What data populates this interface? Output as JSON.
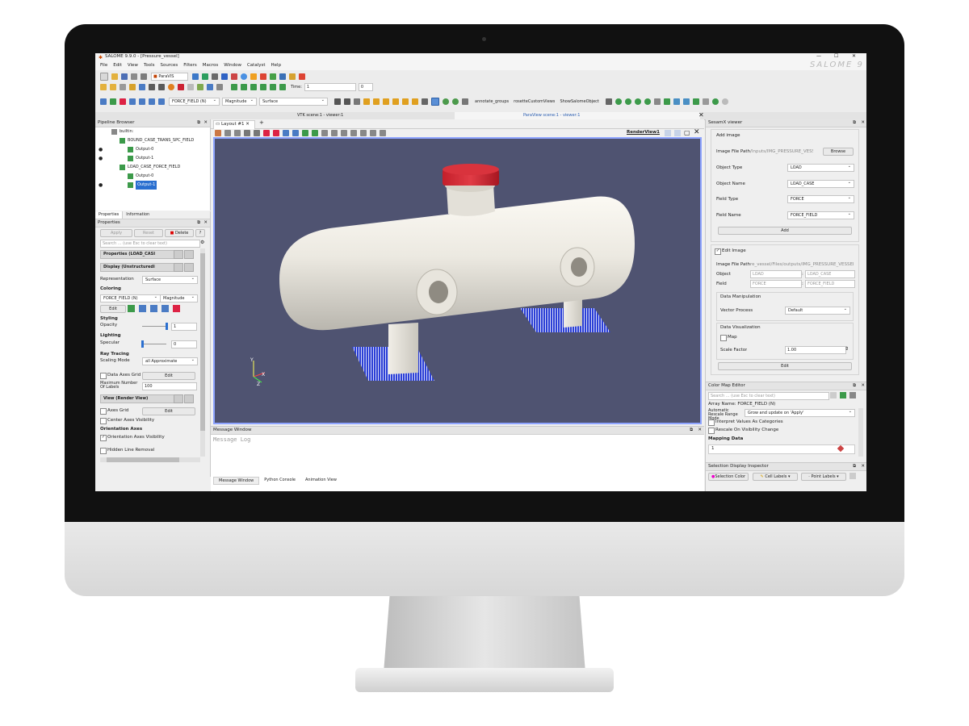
{
  "window": {
    "title": "SALOME 9.9.0 - [Pressure_vessel]",
    "brand": "SALOME 9"
  },
  "menu": [
    "File",
    "Edit",
    "View",
    "Tools",
    "Sources",
    "Filters",
    "Macros",
    "Window",
    "Catalyst",
    "Help"
  ],
  "toolbar": {
    "module_select": "ParaVIS",
    "time_label": "Time:",
    "time_value": "1",
    "time_step": "0",
    "color_field": "FORCE_FIELD (N)",
    "color_component": "Magnitude",
    "representation": "Surface",
    "macro_buttons": [
      "annotate_groups",
      "rosetteCustomViews",
      "ShowSalomeObject"
    ]
  },
  "viewer_tabs": {
    "vtk": "VTK scene:1 - viewer:1",
    "paraview": "ParaView scene:1 - viewer:1"
  },
  "pipeline": {
    "title": "Pipeline Browser",
    "items": [
      "builtin:",
      "BOUND_CASE_TRANS_SPC_FIELD",
      "Output-0",
      "Output-1",
      "LOAD_CASE_FORCE_FIELD",
      "Output-0",
      "Output-1"
    ]
  },
  "props": {
    "tabs": [
      "Properties",
      "Information"
    ],
    "title": "Properties",
    "apply": "Apply",
    "reset": "Reset",
    "delete": "Delete",
    "help": "?",
    "search_placeholder": "Search ... (use Esc to clear text)",
    "group_properties": "Properties (LOAD_CASI",
    "group_display": "Display (Unstructuredi",
    "representation_label": "Representation",
    "representation_value": "Surface",
    "coloring": "Coloring",
    "color_field": "FORCE_FIELD (N)",
    "color_component": "Magnitude",
    "edit": "Edit",
    "styling": "Styling",
    "opacity_label": "Opacity",
    "opacity_value": "1",
    "lighting": "Lighting",
    "specular_label": "Specular",
    "specular_value": "0",
    "ray_tracing": "Ray Tracing",
    "scaling_mode_label": "Scaling Mode",
    "scaling_mode_value": "all Approximate",
    "data_axes_grid": "Data Axes Grid",
    "edit2": "Edit",
    "max_labels_label": "Maximum Number Of Labels",
    "max_labels_value": "100",
    "group_view": "View (Render View)",
    "axes_grid": "Axes Grid",
    "edit3": "Edit",
    "center_axes": "Center Axes Visibility",
    "orientation_axes": "Orientation Axes",
    "orientation_visibility": "Orientation Axes Visibility",
    "hidden_line": "Hidden Line Removal"
  },
  "layout": {
    "tab": "Layout #1",
    "render_view": "RenderView1"
  },
  "message": {
    "title": "Message Window",
    "log": "Message Log",
    "tabs": [
      "Message Window",
      "Python Console",
      "Animation View"
    ]
  },
  "sesamx": {
    "title": "SesamX viewer",
    "add_image": "Add image",
    "file_path_label": "Image File Path",
    "file_path_value": "/Inputs/IMG_PRESSURE_VESSEL.h5",
    "browse": "Browse",
    "object_type_label": "Object Type",
    "object_type_value": "LOAD",
    "object_name_label": "Object Name",
    "object_name_value": "LOAD_CASE",
    "field_type_label": "Field Type",
    "field_type_value": "FORCE",
    "field_name_label": "Field Name",
    "field_name_value": "FORCE_FIELD",
    "add": "Add",
    "edit_image": "Edit Image",
    "edit_path_label": "Image File Path",
    "edit_path_value": "re_vessel/Files/outputs/IMG_PRESSURE_VESSEL.h5",
    "object_label": "Object",
    "object_a": "LOAD",
    "object_b": "LOAD_CASE",
    "field_label": "Field",
    "field_a": "FORCE",
    "field_b": "FORCE_FIELD",
    "data_manipulation": "Data Manipulation",
    "vector_process_label": "Vector Process",
    "vector_process_value": "Default",
    "data_visualization": "Data Visualization",
    "map": "Map",
    "scale_factor_label": "Scale Factor",
    "scale_factor_value": "1.00",
    "edit": "Edit"
  },
  "colormap": {
    "title": "Color Map Editor",
    "search_placeholder": "Search ... (use Esc to clear text)",
    "array_name": "Array Name: FORCE_FIELD (N)",
    "rescale_label": "Automatic Rescale Range Mode",
    "rescale_value": "Grow and update on 'Apply'",
    "interpret": "Interpret Values As Categories",
    "rescale_visibility": "Rescale On Visibility Change",
    "mapping": "Mapping Data",
    "mapping_value": "1"
  },
  "inspector": {
    "title": "Selection Display Inspector",
    "selection_color": "Selection Color",
    "cell_labels": "Cell Labels",
    "point_labels": "Point Labels"
  },
  "colors": {
    "vessel": "#ece9e1",
    "cap": "#c41f2a",
    "background": "#4f5371",
    "bc": "#2b3fd6"
  }
}
